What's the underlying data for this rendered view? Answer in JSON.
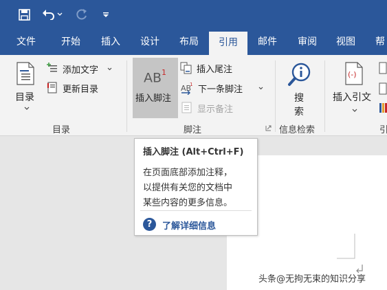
{
  "tabs": [
    {
      "label": "文件"
    },
    {
      "label": "开始"
    },
    {
      "label": "插入"
    },
    {
      "label": "设计"
    },
    {
      "label": "布局"
    },
    {
      "label": "引用",
      "active": true
    },
    {
      "label": "邮件"
    },
    {
      "label": "审阅"
    },
    {
      "label": "视图"
    },
    {
      "label": "帮"
    }
  ],
  "ribbon": {
    "toc": {
      "button": "目录",
      "add_text": "添加文字",
      "update": "更新目录",
      "group": "目录"
    },
    "footnotes": {
      "insert_footnote": "插入脚注",
      "ab_label": "AB",
      "ab_sup": "1",
      "insert_endnote": "插入尾注",
      "next_footnote": "下一条脚注",
      "show_notes": "显示备注",
      "group": "脚注"
    },
    "research": {
      "search_line1": "搜",
      "search_line2": "索",
      "group": "信息检索"
    },
    "citations": {
      "insert_citation": "插入引文",
      "group": "引"
    }
  },
  "tooltip": {
    "title": "插入脚注 (Alt+Ctrl+F)",
    "desc_lines": [
      "在页面底部添加注释，",
      "以提供有关您的文档中",
      "某些内容的更多信息。"
    ],
    "link": "了解详细信息",
    "link_icon": "?"
  },
  "watermark": "头条@无拘无束的知识分享",
  "colors": {
    "brand": "#2b579a",
    "ribbon_bg": "#f3f3f3",
    "hover_bg": "#c5c5c5",
    "workspace": "#e6e6e6"
  }
}
